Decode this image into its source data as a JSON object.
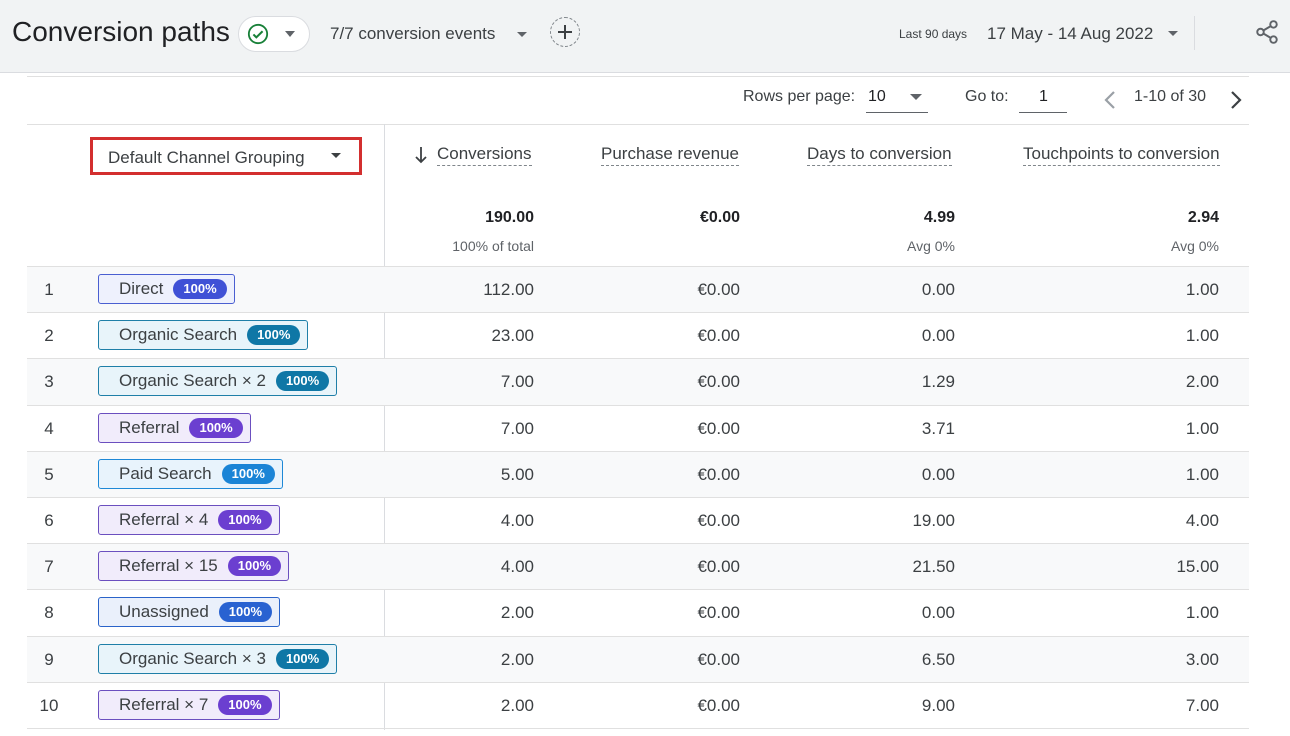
{
  "header": {
    "title": "Conversion paths",
    "events_label": "7/7 conversion events",
    "range_tag": "Last 90 days",
    "date_range": "17 May - 14 Aug 2022"
  },
  "pagination": {
    "rows_label": "Rows per page:",
    "rows_value": "10",
    "goto_label": "Go to:",
    "goto_value": "1",
    "range_text": "1-10 of 30"
  },
  "table": {
    "dimension": "Default Channel Grouping",
    "columns": [
      "Conversions",
      "Purchase revenue",
      "Days to conversion",
      "Touchpoints to conversion"
    ],
    "totals": [
      "190.00",
      "€0.00",
      "4.99",
      "2.94"
    ],
    "subtotals": [
      "100% of total",
      "",
      "Avg 0%",
      "Avg 0%"
    ],
    "rows": [
      {
        "n": "1",
        "path": "Direct",
        "badge": "100%",
        "type": "direct",
        "vals": [
          "112.00",
          "€0.00",
          "0.00",
          "1.00"
        ]
      },
      {
        "n": "2",
        "path": "Organic Search",
        "badge": "100%",
        "type": "organic",
        "vals": [
          "23.00",
          "€0.00",
          "0.00",
          "1.00"
        ]
      },
      {
        "n": "3",
        "path": "Organic Search × 2",
        "badge": "100%",
        "type": "organic",
        "vals": [
          "7.00",
          "€0.00",
          "1.29",
          "2.00"
        ]
      },
      {
        "n": "4",
        "path": "Referral",
        "badge": "100%",
        "type": "referral",
        "vals": [
          "7.00",
          "€0.00",
          "3.71",
          "1.00"
        ]
      },
      {
        "n": "5",
        "path": "Paid Search",
        "badge": "100%",
        "type": "paid",
        "vals": [
          "5.00",
          "€0.00",
          "0.00",
          "1.00"
        ]
      },
      {
        "n": "6",
        "path": "Referral × 4",
        "badge": "100%",
        "type": "referral",
        "vals": [
          "4.00",
          "€0.00",
          "19.00",
          "4.00"
        ]
      },
      {
        "n": "7",
        "path": "Referral × 15",
        "badge": "100%",
        "type": "referral",
        "vals": [
          "4.00",
          "€0.00",
          "21.50",
          "15.00"
        ]
      },
      {
        "n": "8",
        "path": "Unassigned",
        "badge": "100%",
        "type": "unassigned",
        "vals": [
          "2.00",
          "€0.00",
          "0.00",
          "1.00"
        ]
      },
      {
        "n": "9",
        "path": "Organic Search × 3",
        "badge": "100%",
        "type": "organic",
        "vals": [
          "2.00",
          "€0.00",
          "6.50",
          "3.00"
        ]
      },
      {
        "n": "10",
        "path": "Referral × 7",
        "badge": "100%",
        "type": "referral",
        "vals": [
          "2.00",
          "€0.00",
          "9.00",
          "7.00"
        ]
      }
    ]
  },
  "colors": {
    "direct": {
      "border": "#4a5fd1",
      "bg": "#eef1fd",
      "badge": "#3f51d6"
    },
    "organic": {
      "border": "#1f7fa8",
      "bg": "#e8f4fa",
      "badge": "#0f77a6"
    },
    "referral": {
      "border": "#6b4fbf",
      "bg": "#f1ecfb",
      "badge": "#6b3fd0"
    },
    "paid": {
      "border": "#1e88d6",
      "bg": "#e8f3fc",
      "badge": "#1a84d6"
    },
    "unassigned": {
      "border": "#2a63c9",
      "bg": "#eaf0fb",
      "badge": "#2962d1"
    },
    "highlight": "#d32f2f",
    "check": "#188038"
  }
}
